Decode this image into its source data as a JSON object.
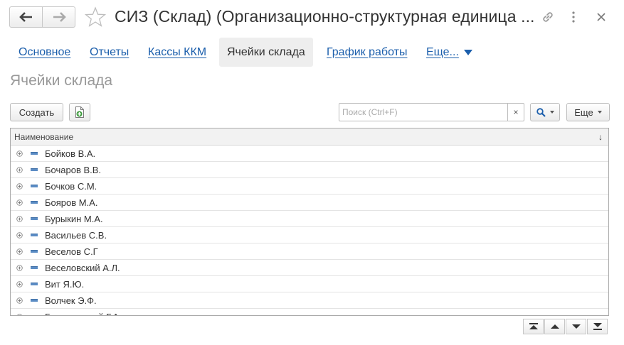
{
  "window": {
    "title": "СИЗ (Склад) (Организационно-структурная единица ..."
  },
  "tabs": [
    {
      "label": "Основное",
      "active": false
    },
    {
      "label": "Отчеты",
      "active": false
    },
    {
      "label": "Кассы ККМ",
      "active": false
    },
    {
      "label": "Ячейки склада",
      "active": true
    },
    {
      "label": "График работы",
      "active": false
    },
    {
      "label": "Еще...",
      "active": false
    }
  ],
  "section_title": "Ячейки склада",
  "toolbar": {
    "create_label": "Создать",
    "search_placeholder": "Поиск (Ctrl+F)",
    "clear_label": "×",
    "more_label": "Еще"
  },
  "table": {
    "column_header": "Наименование",
    "sort_indicator": "↓",
    "rows": [
      "Бойков В.А.",
      "Бочаров В.В.",
      "Бочков С.М.",
      "Бояров М.А.",
      "Бурыкин М.А.",
      "Васильев С.В.",
      "Веселов С.Г",
      "Веселовский А.Л.",
      "Вит Я.Ю.",
      "Волчек Э.Ф.",
      "Гончаровский Г.А."
    ]
  },
  "colors": {
    "link": "#1c5fac",
    "active_tab_bg": "#eeeeee",
    "section_title": "#999999",
    "group_icon": "#5b8cc4",
    "border": "#aaaaaa"
  },
  "icons": {
    "back": "arrow-left-icon",
    "forward": "arrow-right-icon",
    "favorite": "star-icon",
    "link": "link-icon",
    "menu": "more-vertical-icon",
    "close": "close-icon",
    "copy": "create-copy-icon",
    "search": "search-icon",
    "row_expand": "expand-plus-icon",
    "row_group": "group-folder-icon",
    "first": "move-first-icon",
    "prev": "move-up-icon",
    "next": "move-down-icon",
    "last": "move-last-icon"
  }
}
